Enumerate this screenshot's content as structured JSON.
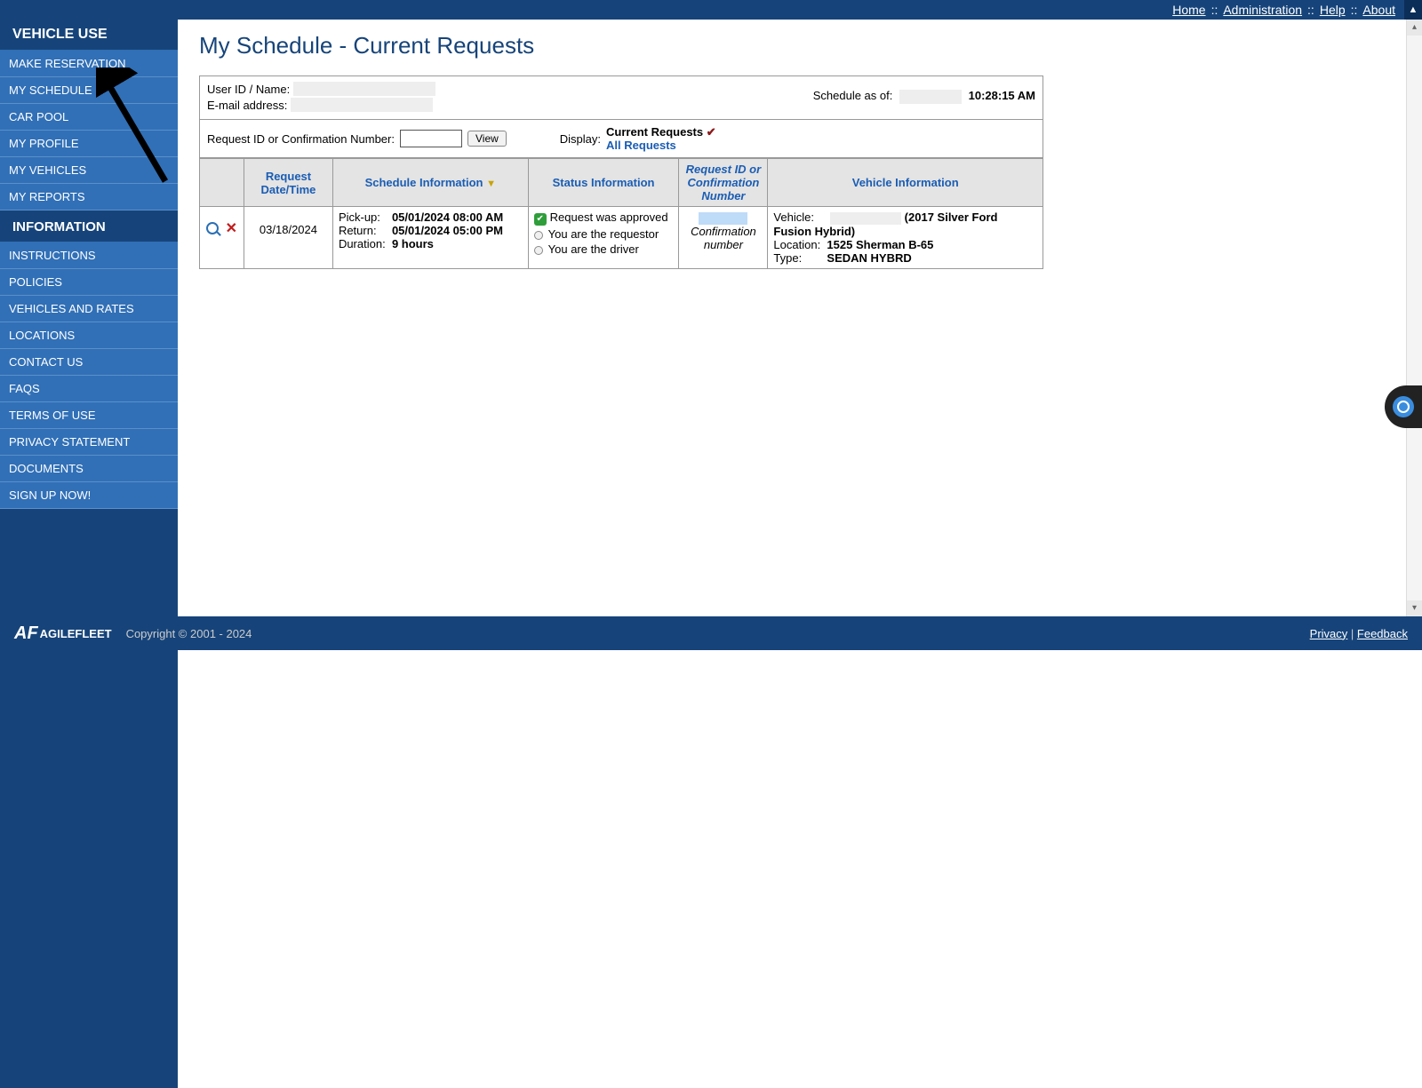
{
  "topnav": {
    "home": "Home",
    "administration": "Administration",
    "help": "Help",
    "about": "About"
  },
  "sidebar": {
    "section1_title": "VEHICLE USE",
    "section1_items": [
      "MAKE RESERVATION",
      "MY SCHEDULE",
      "CAR POOL",
      "MY PROFILE",
      "MY VEHICLES",
      "MY REPORTS"
    ],
    "section2_title": "INFORMATION",
    "section2_items": [
      "INSTRUCTIONS",
      "POLICIES",
      "VEHICLES AND RATES",
      "LOCATIONS",
      "CONTACT US",
      "FAQS",
      "TERMS OF USE",
      "PRIVACY STATEMENT",
      "DOCUMENTS",
      "SIGN UP NOW!"
    ]
  },
  "page": {
    "title": "My Schedule - Current Requests"
  },
  "userinfo": {
    "userid_label": "User ID / Name:",
    "email_label": "E-mail address:",
    "schedule_as_of_label": "Schedule as of:",
    "schedule_time": "10:28:15 AM"
  },
  "search": {
    "label": "Request ID or Confirmation Number:",
    "view_button": "View",
    "display_label": "Display:",
    "current_requests": "Current Requests",
    "all_requests": "All Requests"
  },
  "table": {
    "headers": {
      "request_datetime": "Request Date/Time",
      "schedule_info": "Schedule Information",
      "status_info": "Status Information",
      "confirmation": "Request ID or Confirmation Number",
      "vehicle_info": "Vehicle Information"
    },
    "row": {
      "request_date": "03/18/2024",
      "pickup_label": "Pick-up:",
      "pickup_value": "05/01/2024 08:00 AM",
      "return_label": "Return:",
      "return_value": "05/01/2024 05:00 PM",
      "duration_label": "Duration:",
      "duration_value": "9 hours",
      "status_approved": "Request was approved",
      "status_requestor": "You are the requestor",
      "status_driver": "You are the driver",
      "confirmation_label": "Confirmation number",
      "vehicle_label": "Vehicle:",
      "vehicle_value": "(2017 Silver Ford Fusion Hybrid)",
      "location_label": "Location:",
      "location_value": "1525 Sherman B-65",
      "type_label": "Type:",
      "type_value": "SEDAN HYBRD"
    }
  },
  "footer": {
    "brand": "AGILEFLEET",
    "copyright": "Copyright © 2001 - 2024",
    "privacy": "Privacy",
    "feedback": "Feedback"
  }
}
